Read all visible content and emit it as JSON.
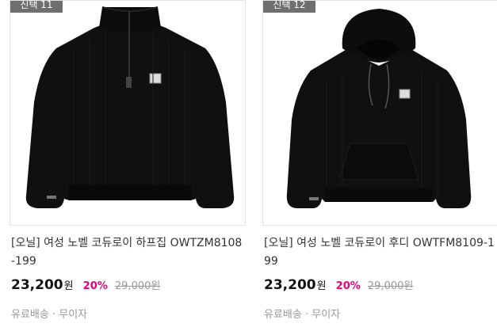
{
  "products": [
    {
      "badge": "신택 11",
      "image_alt": "black corduroy half-zip sweatshirt",
      "title": "[오닐] 여성 노벨 코듀로이 하프집 OWTZM8108-199",
      "price": "23,200",
      "currency": "원",
      "discount": "20%",
      "original_price": "29,000원",
      "shipping": "유료배송 · 무이자"
    },
    {
      "badge": "신택 12",
      "image_alt": "black corduroy hoodie",
      "title": "[오닐] 여성 노벨 코듀로이 후디 OWTFM8109-199",
      "price": "23,200",
      "currency": "원",
      "discount": "20%",
      "original_price": "29,000원",
      "shipping": "유료배송 · 무이자"
    }
  ],
  "colors": {
    "discount": "#e6007e",
    "badge_bg": "#6f6f6f",
    "garment": "#101010"
  }
}
